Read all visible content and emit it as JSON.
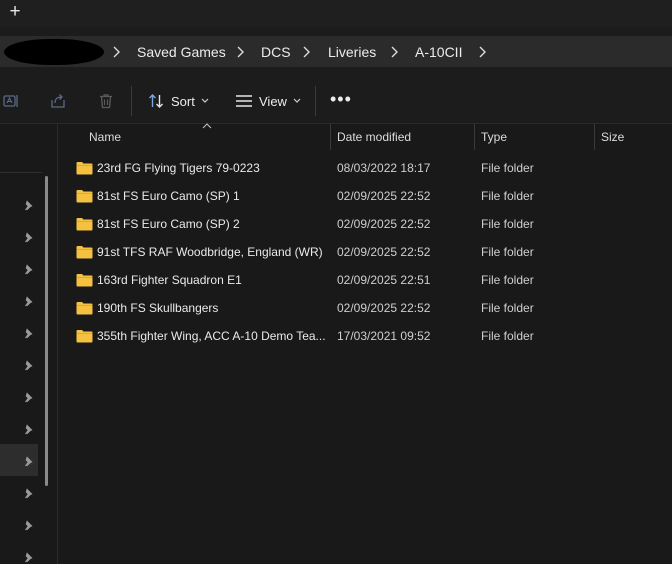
{
  "tabstrip": {
    "new_tab_label": "+"
  },
  "address": {
    "breadcrumbs": [
      "Saved Games",
      "DCS",
      "Liveries",
      "A-10CII"
    ]
  },
  "toolbar": {
    "sort_label": "Sort",
    "view_label": "View",
    "more_label": "•••"
  },
  "columns": {
    "name": "Name",
    "date": "Date modified",
    "type": "Type",
    "size": "Size"
  },
  "files": [
    {
      "name": "23rd FG Flying Tigers 79-0223",
      "date": "08/03/2022 18:17",
      "type": "File folder"
    },
    {
      "name": "81st FS Euro Camo (SP) 1",
      "date": "02/09/2025 22:52",
      "type": "File folder"
    },
    {
      "name": "81st FS Euro Camo (SP) 2",
      "date": "02/09/2025 22:52",
      "type": "File folder"
    },
    {
      "name": "91st TFS RAF Woodbridge, England (WR)",
      "date": "02/09/2025 22:52",
      "type": "File folder"
    },
    {
      "name": "163rd Fighter Squadron E1",
      "date": "02/09/2025 22:51",
      "type": "File folder"
    },
    {
      "name": "190th FS Skullbangers",
      "date": "02/09/2025 22:52",
      "type": "File folder"
    },
    {
      "name": "355th Fighter Wing, ACC A-10 Demo Tea...",
      "date": "17/03/2021 09:52",
      "type": "File folder"
    }
  ],
  "colors": {
    "background": "#191919",
    "folder_yellow": "#f4c141",
    "text": "#eaeaea"
  }
}
